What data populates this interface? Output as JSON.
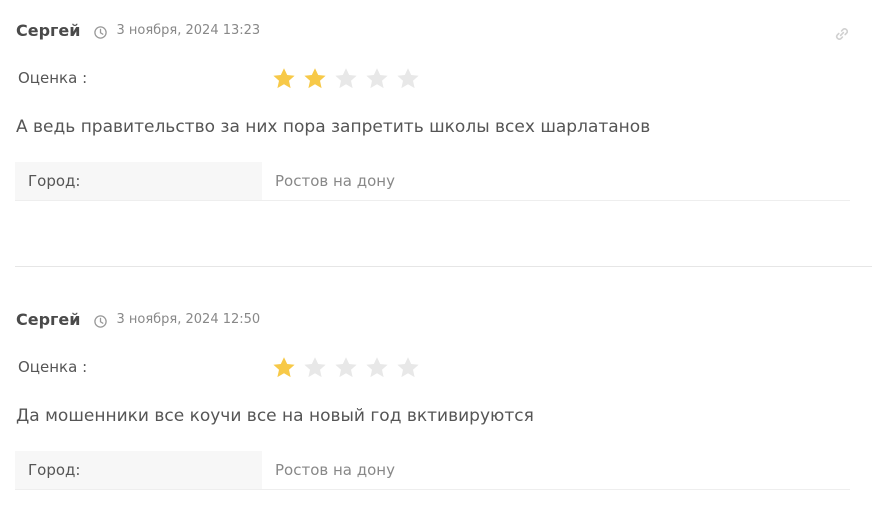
{
  "colors": {
    "star_filled": "#f7c948",
    "star_empty": "#e8e8e8"
  },
  "rating_max": 5,
  "reviews": [
    {
      "author": "Сергей",
      "date": "3 ноября, 2024 13:23",
      "rating_label": "Оценка :",
      "rating": 2,
      "comment": "А ведь правительство за них пора запретить школы всех шарлатанов",
      "city_label": "Город:",
      "city_value": "Ростов на дону"
    },
    {
      "author": "Сергей",
      "date": "3 ноября, 2024 12:50",
      "rating_label": "Оценка :",
      "rating": 1,
      "comment": "Да мошенники все коучи все на новый год вктивируются",
      "city_label": "Город:",
      "city_value": "Ростов на дону"
    }
  ],
  "icons": {
    "clock": "clock-icon",
    "link": "link-icon",
    "star": "star-icon"
  }
}
